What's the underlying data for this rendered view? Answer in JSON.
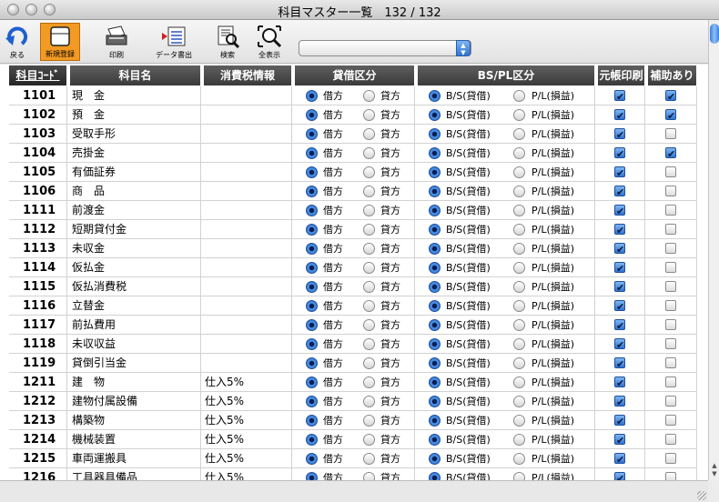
{
  "window": {
    "title": "科目マスター一覧　132 / 132"
  },
  "toolbar": {
    "buttons": [
      {
        "label": "戻る",
        "icon": "back-arrow-icon"
      },
      {
        "label": "新規登録",
        "icon": "new-document-icon"
      },
      {
        "label": "印刷",
        "icon": "printer-icon"
      },
      {
        "label": "データ書出",
        "icon": "export-icon"
      },
      {
        "label": "検索",
        "icon": "search-document-icon"
      },
      {
        "label": "全表示",
        "icon": "show-all-icon"
      }
    ],
    "popup_value": ""
  },
  "columns": [
    "科目ｺｰﾄﾞ",
    "科目名",
    "消費税情報",
    "貸借区分",
    "BS/PL区分",
    "元帳印刷",
    "補助あり"
  ],
  "option_labels": {
    "debit": "借方",
    "credit": "貸方",
    "bs": "B/S(貸借)",
    "pl": "P/L(損益)"
  },
  "rows": [
    {
      "code": "1101",
      "name": "現　金",
      "tax": "",
      "kari": "debit",
      "bspl": "bs",
      "print": true,
      "aux": true
    },
    {
      "code": "1102",
      "name": "預　金",
      "tax": "",
      "kari": "debit",
      "bspl": "bs",
      "print": true,
      "aux": true
    },
    {
      "code": "1103",
      "name": "受取手形",
      "tax": "",
      "kari": "debit",
      "bspl": "bs",
      "print": true,
      "aux": false
    },
    {
      "code": "1104",
      "name": "売掛金",
      "tax": "",
      "kari": "debit",
      "bspl": "bs",
      "print": true,
      "aux": true
    },
    {
      "code": "1105",
      "name": "有価証券",
      "tax": "",
      "kari": "debit",
      "bspl": "bs",
      "print": true,
      "aux": false
    },
    {
      "code": "1106",
      "name": "商　品",
      "tax": "",
      "kari": "debit",
      "bspl": "bs",
      "print": true,
      "aux": false
    },
    {
      "code": "1111",
      "name": "前渡金",
      "tax": "",
      "kari": "debit",
      "bspl": "bs",
      "print": true,
      "aux": false
    },
    {
      "code": "1112",
      "name": "短期貸付金",
      "tax": "",
      "kari": "debit",
      "bspl": "bs",
      "print": true,
      "aux": false
    },
    {
      "code": "1113",
      "name": "未収金",
      "tax": "",
      "kari": "debit",
      "bspl": "bs",
      "print": true,
      "aux": false
    },
    {
      "code": "1114",
      "name": "仮払金",
      "tax": "",
      "kari": "debit",
      "bspl": "bs",
      "print": true,
      "aux": false
    },
    {
      "code": "1115",
      "name": "仮払消費税",
      "tax": "",
      "kari": "debit",
      "bspl": "bs",
      "print": true,
      "aux": false
    },
    {
      "code": "1116",
      "name": "立替金",
      "tax": "",
      "kari": "debit",
      "bspl": "bs",
      "print": true,
      "aux": false
    },
    {
      "code": "1117",
      "name": "前払費用",
      "tax": "",
      "kari": "debit",
      "bspl": "bs",
      "print": true,
      "aux": false
    },
    {
      "code": "1118",
      "name": "未収収益",
      "tax": "",
      "kari": "debit",
      "bspl": "bs",
      "print": true,
      "aux": false
    },
    {
      "code": "1119",
      "name": "貸倒引当金",
      "tax": "",
      "kari": "debit",
      "bspl": "bs",
      "print": true,
      "aux": false
    },
    {
      "code": "1211",
      "name": "建　物",
      "tax": "仕入5%",
      "kari": "debit",
      "bspl": "bs",
      "print": true,
      "aux": false
    },
    {
      "code": "1212",
      "name": "建物付属設備",
      "tax": "仕入5%",
      "kari": "debit",
      "bspl": "bs",
      "print": true,
      "aux": false
    },
    {
      "code": "1213",
      "name": "構築物",
      "tax": "仕入5%",
      "kari": "debit",
      "bspl": "bs",
      "print": true,
      "aux": false
    },
    {
      "code": "1214",
      "name": "機械装置",
      "tax": "仕入5%",
      "kari": "debit",
      "bspl": "bs",
      "print": true,
      "aux": false
    },
    {
      "code": "1215",
      "name": "車両運搬具",
      "tax": "仕入5%",
      "kari": "debit",
      "bspl": "bs",
      "print": true,
      "aux": false
    },
    {
      "code": "1216",
      "name": "工具器具備品",
      "tax": "仕入5%",
      "kari": "debit",
      "bspl": "bs",
      "print": true,
      "aux": false
    }
  ]
}
